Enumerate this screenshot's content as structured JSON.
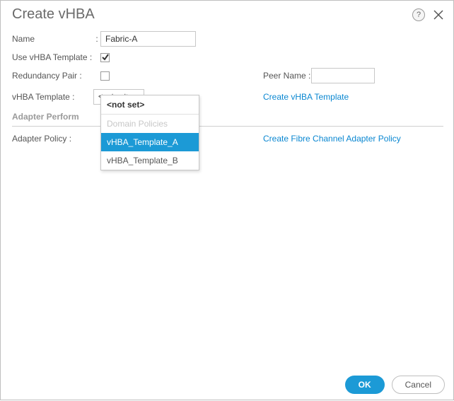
{
  "dialog": {
    "title": "Create vHBA"
  },
  "labels": {
    "name": "Name",
    "use_template": "Use vHBA Template :",
    "redundancy_pair": "Redundancy Pair :",
    "peer_name": "Peer Name :",
    "vhba_template": "vHBA Template :",
    "section_adapter_perf": "Adapter Perform",
    "adapter_policy": "Adapter Policy :"
  },
  "values": {
    "name": "Fabric-A",
    "use_template_checked": true,
    "redundancy_pair_checked": false,
    "peer_name": "",
    "vhba_template_selected": "<not set>",
    "adapter_policy_selected": ""
  },
  "links": {
    "create_template": "Create vHBA Template",
    "create_adapter_policy": "Create Fibre Channel Adapter Policy"
  },
  "dropdown": {
    "items": [
      {
        "label": "<not set>",
        "kind": "notset"
      },
      {
        "label": "Domain Policies",
        "kind": "disabled"
      },
      {
        "label": "vHBA_Template_A",
        "kind": "selected"
      },
      {
        "label": "vHBA_Template_B",
        "kind": "normal"
      }
    ]
  },
  "footer": {
    "ok": "OK",
    "cancel": "Cancel"
  },
  "icons": {
    "help": "?",
    "close": "x"
  }
}
